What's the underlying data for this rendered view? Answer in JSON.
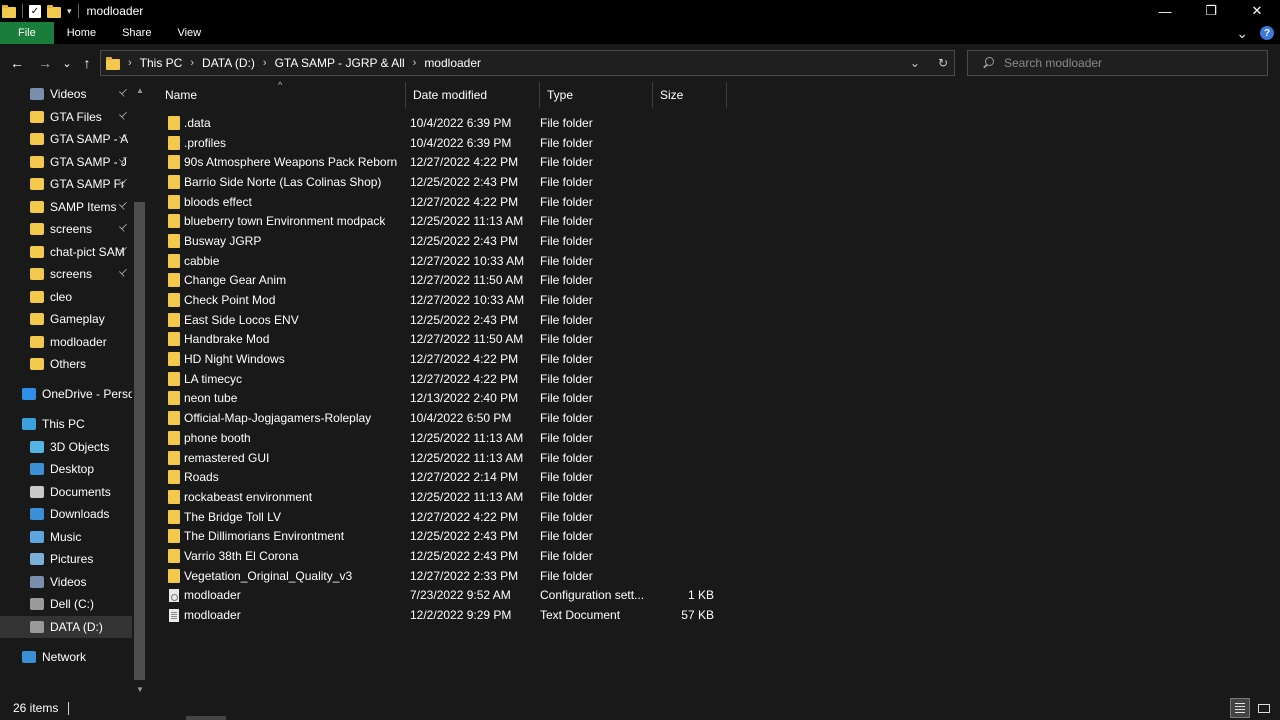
{
  "window": {
    "title": "modloader",
    "minimize_glyph": "—",
    "maximize_glyph": "❐",
    "close_glyph": "✕"
  },
  "quick_access_toolbar": {
    "dropdown_glyph": "▾"
  },
  "ribbon": {
    "tabs": [
      "File",
      "Home",
      "Share",
      "View"
    ],
    "expand_glyph": "⌄",
    "help_glyph": "?"
  },
  "navigation": {
    "back_glyph": "←",
    "forward_glyph": "→",
    "recent_glyph": "⌄",
    "up_glyph": "↑"
  },
  "address_bar": {
    "breadcrumbs": [
      "This PC",
      "DATA (D:)",
      "GTA SAMP - JGRP & All",
      "modloader"
    ],
    "separator": "›",
    "dropdown_glyph": "⌄",
    "refresh_glyph": "↻"
  },
  "search": {
    "placeholder": "Search modloader"
  },
  "nav_pane": {
    "quick_access": [
      {
        "label": "Videos",
        "icon": "videos-icon",
        "pinned": true
      },
      {
        "label": "GTA Files",
        "icon": "folder-icon",
        "pinned": true
      },
      {
        "label": "GTA SAMP - A",
        "icon": "folder-icon",
        "pinned": true
      },
      {
        "label": "GTA SAMP - J",
        "icon": "folder-icon",
        "pinned": true
      },
      {
        "label": "GTA SAMP Fr",
        "icon": "folder-icon",
        "pinned": true
      },
      {
        "label": "SAMP Items",
        "icon": "folder-icon",
        "pinned": true
      },
      {
        "label": "screens",
        "icon": "folder-icon",
        "pinned": true
      },
      {
        "label": "chat-pict SAM",
        "icon": "folder-icon",
        "pinned": true
      },
      {
        "label": "screens",
        "icon": "folder-icon",
        "pinned": true
      },
      {
        "label": "cleo",
        "icon": "folder-icon",
        "pinned": false
      },
      {
        "label": "Gameplay",
        "icon": "folder-icon",
        "pinned": false
      },
      {
        "label": "modloader",
        "icon": "folder-icon",
        "pinned": false
      },
      {
        "label": "Others",
        "icon": "folder-icon",
        "pinned": false
      }
    ],
    "onedrive": {
      "label": "OneDrive - Person",
      "icon": "onedrive-icon"
    },
    "this_pc": {
      "label": "This PC",
      "icon": "this-pc-icon"
    },
    "this_pc_items": [
      {
        "label": "3D Objects",
        "icon": "3d-objects-icon"
      },
      {
        "label": "Desktop",
        "icon": "desktop-icon"
      },
      {
        "label": "Documents",
        "icon": "documents-icon"
      },
      {
        "label": "Downloads",
        "icon": "downloads-icon"
      },
      {
        "label": "Music",
        "icon": "music-icon"
      },
      {
        "label": "Pictures",
        "icon": "pictures-icon"
      },
      {
        "label": "Videos",
        "icon": "videos-icon"
      },
      {
        "label": "Dell (C:)",
        "icon": "drive-icon"
      },
      {
        "label": "DATA (D:)",
        "icon": "drive-icon",
        "selected": true
      }
    ],
    "network": {
      "label": "Network",
      "icon": "network-icon"
    },
    "pin_glyph": "📌",
    "scroll_up_glyph": "▲",
    "scroll_down_glyph": "▼"
  },
  "columns": {
    "name": "Name",
    "date": "Date modified",
    "type": "Type",
    "size": "Size",
    "sort_glyph": "^"
  },
  "files": [
    {
      "name": ".data",
      "date": "10/4/2022 6:39 PM",
      "type": "File folder",
      "size": "",
      "kind": "folder"
    },
    {
      "name": ".profiles",
      "date": "10/4/2022 6:39 PM",
      "type": "File folder",
      "size": "",
      "kind": "folder"
    },
    {
      "name": "90s Atmosphere Weapons Pack Reborn",
      "date": "12/27/2022 4:22 PM",
      "type": "File folder",
      "size": "",
      "kind": "folder"
    },
    {
      "name": "Barrio Side Norte (Las Colinas Shop)",
      "date": "12/25/2022 2:43 PM",
      "type": "File folder",
      "size": "",
      "kind": "folder"
    },
    {
      "name": "bloods effect",
      "date": "12/27/2022 4:22 PM",
      "type": "File folder",
      "size": "",
      "kind": "folder"
    },
    {
      "name": "blueberry town Environment modpack",
      "date": "12/25/2022 11:13 AM",
      "type": "File folder",
      "size": "",
      "kind": "folder"
    },
    {
      "name": "Busway JGRP",
      "date": "12/25/2022 2:43 PM",
      "type": "File folder",
      "size": "",
      "kind": "folder"
    },
    {
      "name": "cabbie",
      "date": "12/27/2022 10:33 AM",
      "type": "File folder",
      "size": "",
      "kind": "folder"
    },
    {
      "name": "Change Gear Anim",
      "date": "12/27/2022 11:50 AM",
      "type": "File folder",
      "size": "",
      "kind": "folder"
    },
    {
      "name": "Check Point Mod",
      "date": "12/27/2022 10:33 AM",
      "type": "File folder",
      "size": "",
      "kind": "folder"
    },
    {
      "name": "East Side Locos ENV",
      "date": "12/25/2022 2:43 PM",
      "type": "File folder",
      "size": "",
      "kind": "folder"
    },
    {
      "name": "Handbrake Mod",
      "date": "12/27/2022 11:50 AM",
      "type": "File folder",
      "size": "",
      "kind": "folder"
    },
    {
      "name": "HD Night Windows",
      "date": "12/27/2022 4:22 PM",
      "type": "File folder",
      "size": "",
      "kind": "folder"
    },
    {
      "name": "LA timecyc",
      "date": "12/27/2022 4:22 PM",
      "type": "File folder",
      "size": "",
      "kind": "folder"
    },
    {
      "name": "neon tube",
      "date": "12/13/2022 2:40 PM",
      "type": "File folder",
      "size": "",
      "kind": "folder"
    },
    {
      "name": "Official-Map-Jogjagamers-Roleplay",
      "date": "10/4/2022 6:50 PM",
      "type": "File folder",
      "size": "",
      "kind": "folder"
    },
    {
      "name": "phone booth",
      "date": "12/25/2022 11:13 AM",
      "type": "File folder",
      "size": "",
      "kind": "folder"
    },
    {
      "name": "remastered GUI",
      "date": "12/25/2022 11:13 AM",
      "type": "File folder",
      "size": "",
      "kind": "folder"
    },
    {
      "name": "Roads",
      "date": "12/27/2022 2:14 PM",
      "type": "File folder",
      "size": "",
      "kind": "folder"
    },
    {
      "name": "rockabeast environment",
      "date": "12/25/2022 11:13 AM",
      "type": "File folder",
      "size": "",
      "kind": "folder"
    },
    {
      "name": "The Bridge Toll LV",
      "date": "12/27/2022 4:22 PM",
      "type": "File folder",
      "size": "",
      "kind": "folder"
    },
    {
      "name": "The Dillimorians Environtment",
      "date": "12/25/2022 2:43 PM",
      "type": "File folder",
      "size": "",
      "kind": "folder"
    },
    {
      "name": "Varrio 38th El Corona",
      "date": "12/25/2022 2:43 PM",
      "type": "File folder",
      "size": "",
      "kind": "folder"
    },
    {
      "name": "Vegetation_Original_Quality_v3",
      "date": "12/27/2022 2:33 PM",
      "type": "File folder",
      "size": "",
      "kind": "folder"
    },
    {
      "name": "modloader",
      "date": "7/23/2022 9:52 AM",
      "type": "Configuration sett...",
      "size": "1 KB",
      "kind": "config"
    },
    {
      "name": "modloader",
      "date": "12/2/2022 9:29 PM",
      "type": "Text Document",
      "size": "57 KB",
      "kind": "text"
    }
  ],
  "status": {
    "item_count": "26 items"
  },
  "colors": {
    "background": "#191919",
    "titlebar": "#000000",
    "file_tab": "#1b7d3b",
    "folder": "#f2c94c",
    "selected": "#333333"
  }
}
